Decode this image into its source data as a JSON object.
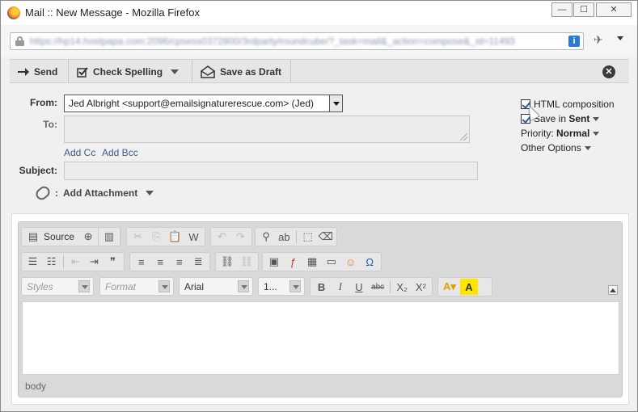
{
  "window": {
    "title": "Mail :: New Message - Mozilla Firefox",
    "url": "https://hp14.hostpapa.com:2096/cpsess0372800/3rdparty/roundcube/?_task=mail&_action=compose&_id=11493"
  },
  "toolbar": {
    "send_label": "Send",
    "spell_label": "Check Spelling",
    "draft_label": "Save as Draft"
  },
  "form": {
    "from_label": "From:",
    "from_value": "Jed Albright <support@emailsignaturerescue.com> (Jed)",
    "to_label": "To:",
    "to_value": "",
    "add_cc": "Add Cc",
    "add_bcc": "Add Bcc",
    "subject_label": "Subject:",
    "subject_value": "",
    "attach_label": "Add Attachment"
  },
  "options": {
    "html_composition": "HTML composition",
    "html_checked": true,
    "save_in_prefix": "Save in",
    "save_in_folder": "Sent",
    "save_checked": true,
    "priority_label": "Priority:",
    "priority_value": "Normal",
    "other_options": "Other Options"
  },
  "editor": {
    "source_label": "Source",
    "styles_placeholder": "Styles",
    "format_placeholder": "Format",
    "font_value": "Arial",
    "size_value": "1...",
    "status_path": "body",
    "toolbar_glyphs": {
      "bold": "B",
      "italic": "I",
      "underline": "U",
      "strike": "abc",
      "subscript": "X₂",
      "superscript": "X²",
      "quote": "❞",
      "omega": "Ω"
    }
  }
}
